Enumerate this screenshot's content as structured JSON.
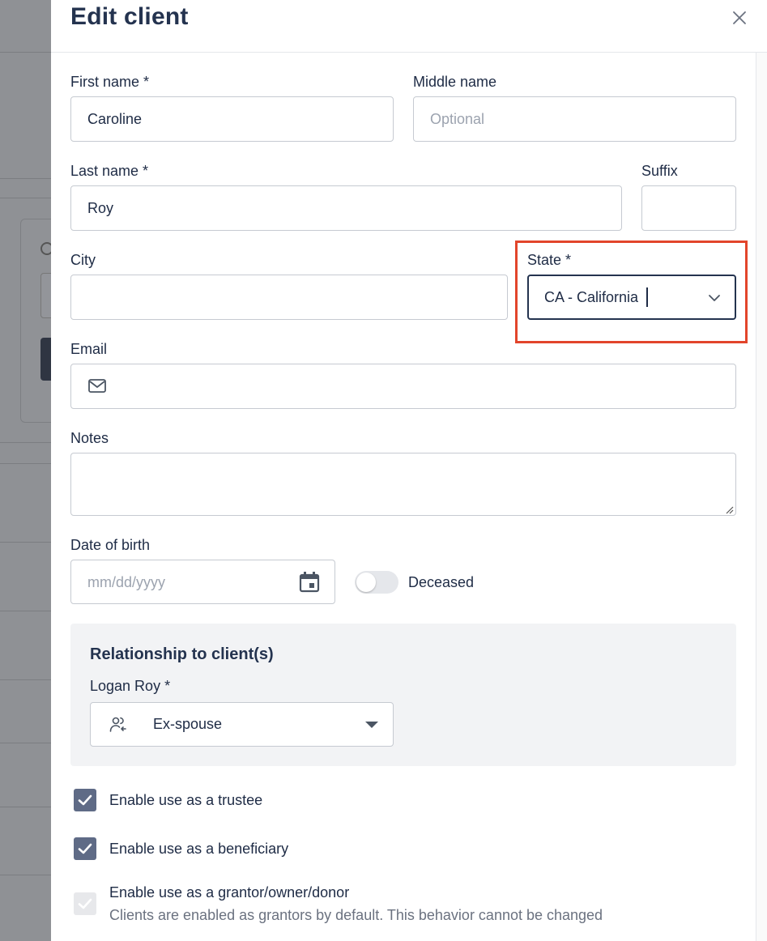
{
  "drawer": {
    "title": "Edit client"
  },
  "form": {
    "first_name": {
      "label": "First name *",
      "value": "Caroline"
    },
    "middle_name": {
      "label": "Middle name",
      "placeholder": "Optional"
    },
    "last_name": {
      "label": "Last name *",
      "value": "Roy"
    },
    "suffix": {
      "label": "Suffix",
      "value": ""
    },
    "city": {
      "label": "City",
      "value": ""
    },
    "state": {
      "label": "State *",
      "value": "CA - California"
    },
    "email": {
      "label": "Email",
      "value": "",
      "icon": "mail-icon"
    },
    "notes": {
      "label": "Notes",
      "value": ""
    },
    "dob": {
      "label": "Date of birth",
      "placeholder": "mm/dd/yyyy",
      "icon": "calendar-icon"
    },
    "deceased": {
      "label": "Deceased",
      "on": false
    }
  },
  "relationship": {
    "title": "Relationship to client(s)",
    "client_label": "Logan Roy *",
    "value": "Ex-spouse",
    "icon": "users-icon"
  },
  "checkboxes": [
    {
      "label": "Enable use as a trustee",
      "checked": true,
      "disabled": false
    },
    {
      "label": "Enable use as a beneficiary",
      "checked": true,
      "disabled": false
    },
    {
      "label": "Enable use as a grantor/owner/donor",
      "checked": true,
      "disabled": true,
      "help": "Clients are enabled as grantors by default. This behavior cannot be changed"
    }
  ],
  "colors": {
    "highlight": "#e2452b",
    "checkbox": "#5f6b86",
    "title": "#24334f"
  }
}
